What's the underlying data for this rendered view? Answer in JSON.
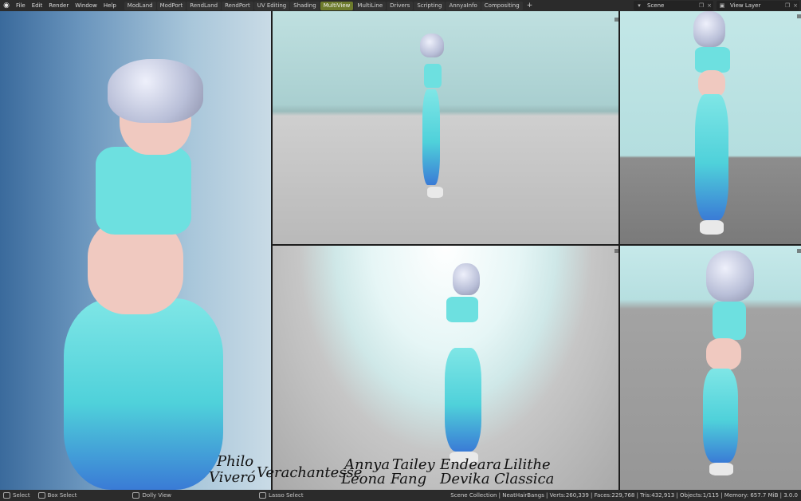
{
  "topbar": {
    "logo_icon": "blender-logo-icon",
    "menu": [
      "File",
      "Edit",
      "Render",
      "Window",
      "Help"
    ],
    "workspaces": [
      "ModLand",
      "ModPort",
      "RendLand",
      "RendPort",
      "UV Editing",
      "Shading",
      "MultiView",
      "MultiLine",
      "Drivers",
      "Scripting",
      "AnnyaInfo",
      "Compositing"
    ],
    "active_workspace": "MultiView",
    "add_tab": "+",
    "scene_label": "Scene",
    "view_layer_label": "View Layer"
  },
  "signature": [
    "Philo",
    "Viveró",
    "Verachantesse",
    "Annya",
    "Leona",
    "Tailey",
    "Fang",
    "Endeara",
    "Devika",
    "Lilithe",
    "Classica"
  ],
  "statusbar": {
    "select": "Select",
    "box_select": "Box Select",
    "dolly_view": "Dolly View",
    "lasso_select": "Lasso Select",
    "stats": "Scene Collection | NeatHairBangs | Verts:260,339 | Faces:229,768 | Tris:432,913 | Objects:1/115 | Memory: 657.7 MiB | 3.0.0"
  },
  "colors": {
    "active_tab": "#6d7b2c",
    "pants": "#4fd1da",
    "top": "#6de0e0",
    "hair": "#b9bfd8"
  }
}
